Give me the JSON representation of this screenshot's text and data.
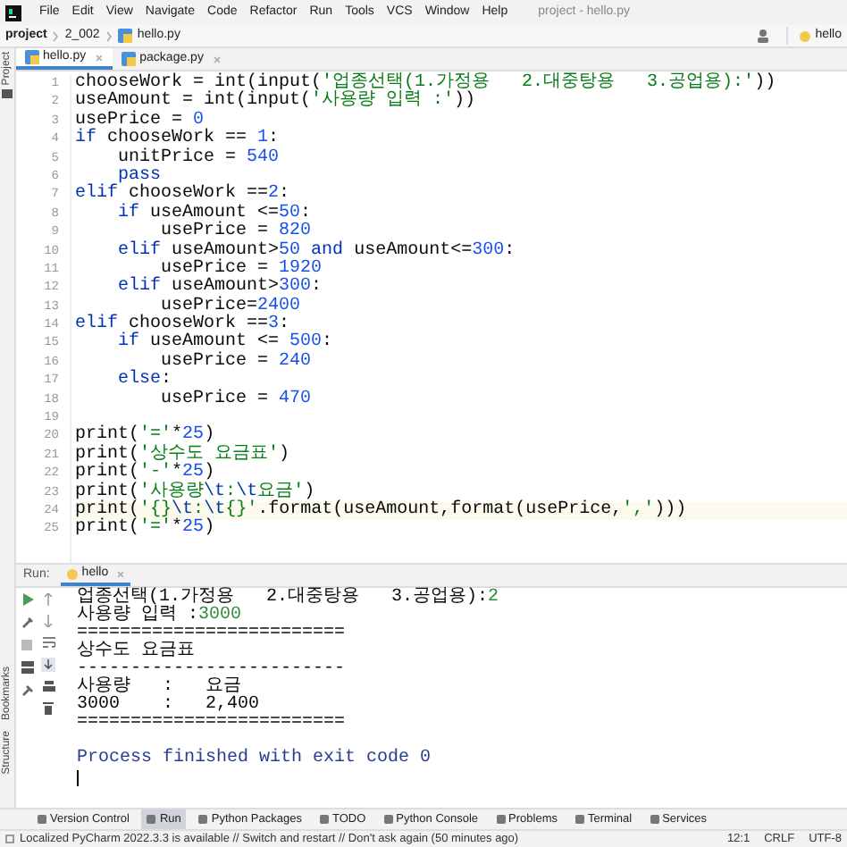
{
  "menu": {
    "items": [
      "File",
      "Edit",
      "View",
      "Navigate",
      "Code",
      "Refactor",
      "Run",
      "Tools",
      "VCS",
      "Window",
      "Help"
    ],
    "title": "project - hello.py"
  },
  "breadcrumb": [
    "project",
    "2_002",
    "hello.py"
  ],
  "run_config": "hello",
  "side_labels": {
    "top": "Project",
    "bottom": [
      "Bookmarks",
      "Structure"
    ]
  },
  "tabs": [
    {
      "label": "hello.py",
      "selected": true
    },
    {
      "label": "package.py",
      "selected": false
    }
  ],
  "code": [
    {
      "n": "1",
      "tokens": [
        {
          "kind": "plain",
          "text": "chooseWork = int(input("
        },
        {
          "kind": "string",
          "text": "'업종선택(1.가정용   2.대중탕용   3.공업용):'"
        },
        {
          "kind": "plain",
          "text": "))"
        }
      ]
    },
    {
      "n": "2",
      "tokens": [
        {
          "kind": "plain",
          "text": "useAmount = int(input("
        },
        {
          "kind": "string",
          "text": "'사용량 입력 :'"
        },
        {
          "kind": "plain",
          "text": "))"
        }
      ]
    },
    {
      "n": "3",
      "tokens": [
        {
          "kind": "plain",
          "text": "usePrice = "
        },
        {
          "kind": "number",
          "text": "0"
        }
      ]
    },
    {
      "n": "4",
      "tokens": [
        {
          "kind": "keyword",
          "text": "if"
        },
        {
          "kind": "plain",
          "text": " chooseWork == "
        },
        {
          "kind": "number",
          "text": "1"
        },
        {
          "kind": "plain",
          "text": ":"
        }
      ]
    },
    {
      "n": "5",
      "tokens": [
        {
          "kind": "plain",
          "text": "    unitPrice = "
        },
        {
          "kind": "number",
          "text": "540"
        }
      ]
    },
    {
      "n": "6",
      "tokens": [
        {
          "kind": "keyword",
          "text": "    pass"
        }
      ]
    },
    {
      "n": "7",
      "tokens": [
        {
          "kind": "keyword",
          "text": "elif"
        },
        {
          "kind": "plain",
          "text": " chooseWork =="
        },
        {
          "kind": "number",
          "text": "2"
        },
        {
          "kind": "plain",
          "text": ":"
        }
      ]
    },
    {
      "n": "8",
      "tokens": [
        {
          "kind": "keyword",
          "text": "    if"
        },
        {
          "kind": "plain",
          "text": " useAmount <="
        },
        {
          "kind": "number",
          "text": "50"
        },
        {
          "kind": "plain",
          "text": ":"
        }
      ]
    },
    {
      "n": "9",
      "tokens": [
        {
          "kind": "plain",
          "text": "        usePrice = "
        },
        {
          "kind": "number",
          "text": "820"
        }
      ]
    },
    {
      "n": "10",
      "tokens": [
        {
          "kind": "keyword",
          "text": "    elif"
        },
        {
          "kind": "plain",
          "text": " useAmount>"
        },
        {
          "kind": "number",
          "text": "50"
        },
        {
          "kind": "keyword",
          "text": " and"
        },
        {
          "kind": "plain",
          "text": " useAmount<="
        },
        {
          "kind": "number",
          "text": "300"
        },
        {
          "kind": "plain",
          "text": ":"
        }
      ]
    },
    {
      "n": "11",
      "tokens": [
        {
          "kind": "plain",
          "text": "        usePrice = "
        },
        {
          "kind": "number",
          "text": "1920"
        }
      ]
    },
    {
      "n": "12",
      "tokens": [
        {
          "kind": "keyword",
          "text": "    elif"
        },
        {
          "kind": "plain",
          "text": " useAmount>"
        },
        {
          "kind": "number",
          "text": "300"
        },
        {
          "kind": "plain",
          "text": ":"
        }
      ]
    },
    {
      "n": "13",
      "tokens": [
        {
          "kind": "plain",
          "text": "        usePrice="
        },
        {
          "kind": "number",
          "text": "2400"
        }
      ]
    },
    {
      "n": "14",
      "tokens": [
        {
          "kind": "keyword",
          "text": "elif"
        },
        {
          "kind": "plain",
          "text": " chooseWork =="
        },
        {
          "kind": "number",
          "text": "3"
        },
        {
          "kind": "plain",
          "text": ":"
        }
      ]
    },
    {
      "n": "15",
      "tokens": [
        {
          "kind": "keyword",
          "text": "    if"
        },
        {
          "kind": "plain",
          "text": " useAmount <= "
        },
        {
          "kind": "number",
          "text": "500"
        },
        {
          "kind": "plain",
          "text": ":"
        }
      ]
    },
    {
      "n": "16",
      "tokens": [
        {
          "kind": "plain",
          "text": "        usePrice = "
        },
        {
          "kind": "number",
          "text": "240"
        }
      ]
    },
    {
      "n": "17",
      "tokens": [
        {
          "kind": "keyword",
          "text": "    else"
        },
        {
          "kind": "plain",
          "text": ":"
        }
      ]
    },
    {
      "n": "18",
      "tokens": [
        {
          "kind": "plain",
          "text": "        usePrice = "
        },
        {
          "kind": "number",
          "text": "470"
        }
      ]
    },
    {
      "n": "19"
    },
    {
      "n": "20",
      "tokens": [
        {
          "kind": "plain",
          "text": "print("
        },
        {
          "kind": "string",
          "text": "'='"
        },
        {
          "kind": "plain",
          "text": "*"
        },
        {
          "kind": "number",
          "text": "25"
        },
        {
          "kind": "plain",
          "text": ")"
        }
      ]
    },
    {
      "n": "21",
      "tokens": [
        {
          "kind": "plain",
          "text": "print("
        },
        {
          "kind": "string",
          "text": "'상수도 요금표'"
        },
        {
          "kind": "plain",
          "text": ")"
        }
      ]
    },
    {
      "n": "22",
      "tokens": [
        {
          "kind": "plain",
          "text": "print("
        },
        {
          "kind": "string",
          "text": "'-'"
        },
        {
          "kind": "plain",
          "text": "*"
        },
        {
          "kind": "number",
          "text": "25"
        },
        {
          "kind": "plain",
          "text": ")"
        }
      ]
    },
    {
      "n": "23",
      "tokens": [
        {
          "kind": "plain",
          "text": "print("
        },
        {
          "kind": "string",
          "text": "'사용량"
        },
        {
          "kind": "escape",
          "text": "\\t"
        },
        {
          "kind": "string",
          "text": ":"
        },
        {
          "kind": "escape",
          "text": "\\t"
        },
        {
          "kind": "string",
          "text": "요금'"
        },
        {
          "kind": "plain",
          "text": ")"
        }
      ]
    },
    {
      "n": "24",
      "current": true,
      "tokens": [
        {
          "kind": "plain",
          "text": "print("
        },
        {
          "kind": "string",
          "text": "'{}"
        },
        {
          "kind": "escape",
          "text": "\\t"
        },
        {
          "kind": "string",
          "text": ":"
        },
        {
          "kind": "escape",
          "text": "\\t"
        },
        {
          "kind": "string",
          "text": "{}'"
        },
        {
          "kind": "plain",
          "text": ".format(useAmount,format(usePrice,"
        },
        {
          "kind": "string",
          "text": "','"
        },
        {
          "kind": "plain",
          "text": ")))"
        }
      ]
    },
    {
      "n": "25",
      "tokens": [
        {
          "kind": "plain",
          "text": "print("
        },
        {
          "kind": "string",
          "text": "'='"
        },
        {
          "kind": "plain",
          "text": "*"
        },
        {
          "kind": "number",
          "text": "25"
        },
        {
          "kind": "plain",
          "text": ")"
        }
      ]
    }
  ],
  "run": {
    "label": "Run:",
    "tab": "hello",
    "output": [
      {
        "parts": [
          {
            "kind": "output",
            "text": "업종선택(1.가정용   2.대중탕용   3.공업용):"
          },
          {
            "kind": "input",
            "text": "2"
          }
        ]
      },
      {
        "parts": [
          {
            "kind": "output",
            "text": "사용량 입력 :"
          },
          {
            "kind": "input",
            "text": "3000"
          }
        ]
      },
      {
        "parts": [
          {
            "kind": "output",
            "text": "========================="
          }
        ]
      },
      {
        "parts": [
          {
            "kind": "output",
            "text": "상수도 요금표"
          }
        ]
      },
      {
        "parts": [
          {
            "kind": "output",
            "text": "-------------------------"
          }
        ]
      },
      {
        "parts": [
          {
            "kind": "output",
            "text": "사용량   :   요금"
          }
        ]
      },
      {
        "parts": [
          {
            "kind": "output",
            "text": "3000    :   2,400"
          }
        ]
      },
      {
        "parts": [
          {
            "kind": "output",
            "text": "========================="
          }
        ]
      },
      {
        "gap_before": true,
        "parts": [
          {
            "kind": "system",
            "text": "Process finished with exit code 0"
          }
        ]
      }
    ]
  },
  "tool_tabs": [
    {
      "label": "Version Control",
      "selected": false
    },
    {
      "label": "Run",
      "selected": true
    },
    {
      "label": "Python Packages",
      "selected": false
    },
    {
      "label": "TODO",
      "selected": false
    },
    {
      "label": "Python Console",
      "selected": false
    },
    {
      "label": "Problems",
      "selected": false
    },
    {
      "label": "Terminal",
      "selected": false
    },
    {
      "label": "Services",
      "selected": false
    }
  ],
  "status_bar": {
    "message": "Localized PyCharm 2022.3.3 is available // Switch and restart // Don't ask again (50 minutes ago)",
    "position": "12:1",
    "line_ending": "CRLF",
    "encoding": "UTF-8"
  }
}
